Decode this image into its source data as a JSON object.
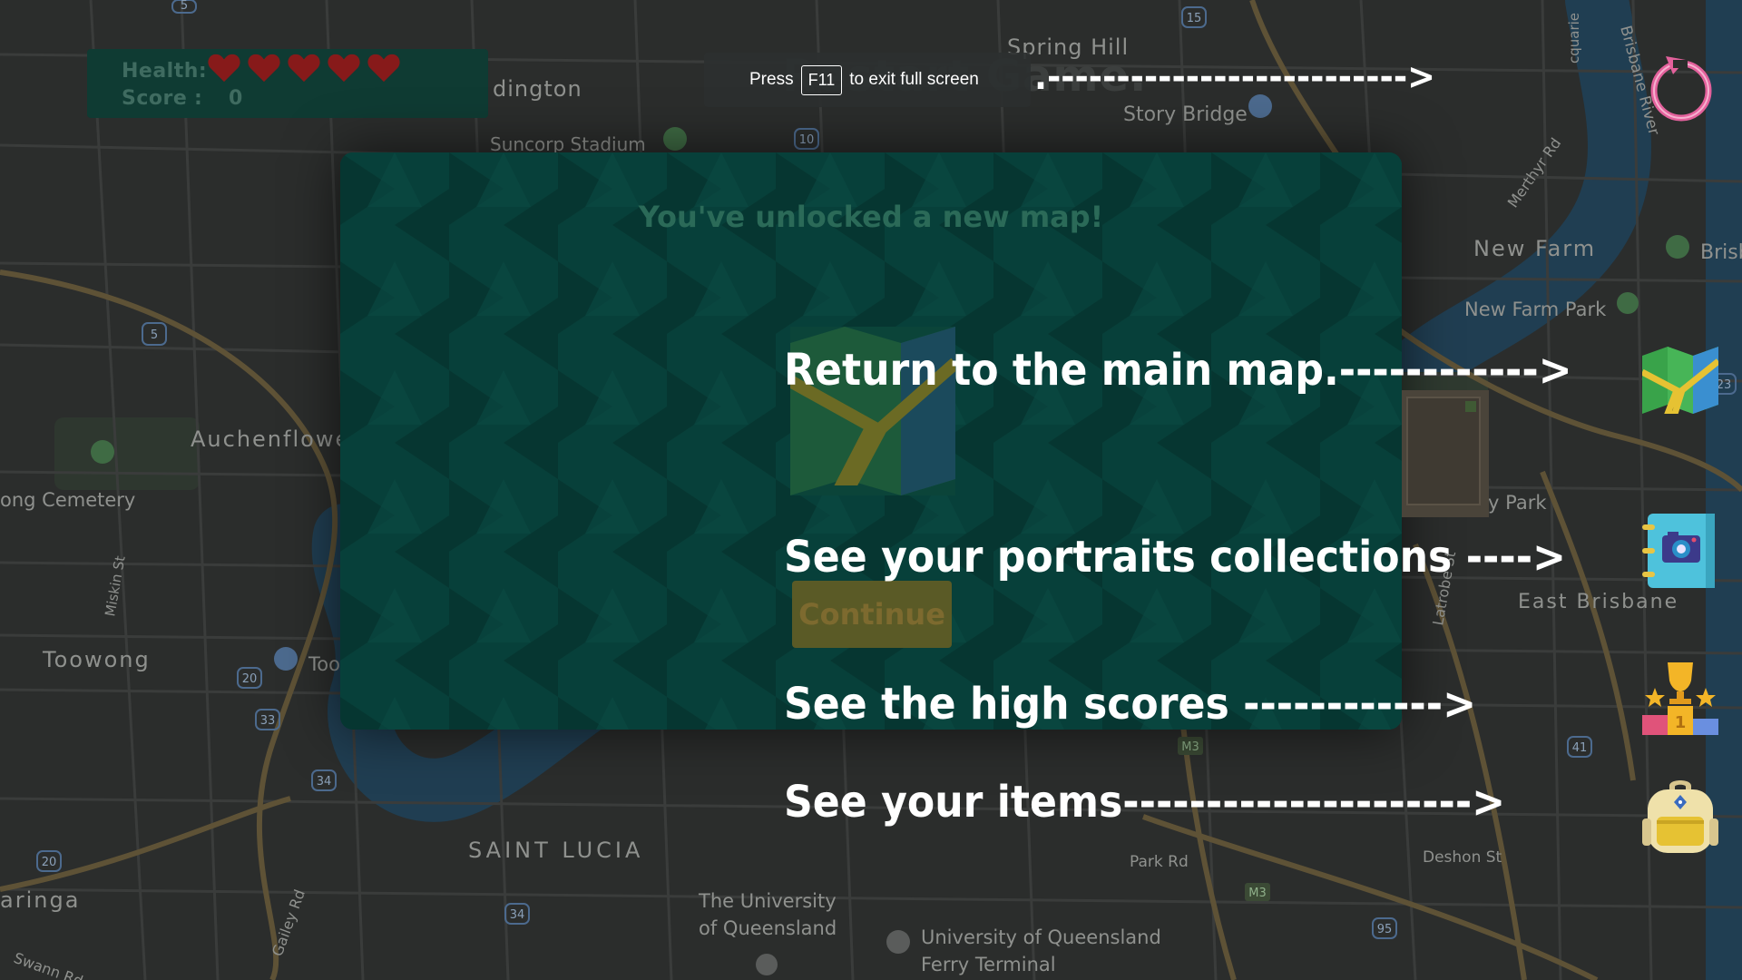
{
  "hud": {
    "health_label": "Health:",
    "score_label": "Score",
    "score_sep": ":",
    "score_value": "0",
    "hearts": 5
  },
  "fullscreen_notice": {
    "prefix": "Press",
    "key": "F11",
    "suffix": "to exit full screen"
  },
  "restart_title": "Restart Game.",
  "modal": {
    "title": "You've unlocked a new map!",
    "continue_label": "Continue"
  },
  "hints": {
    "restart_arrow": ".-------------------------->",
    "main_map": "Return to the main map.------------>",
    "portraits": "See your portraits collections ---->",
    "high_scores": "See the high scores ------------>",
    "items": "See your items--------------------->"
  },
  "map_labels": {
    "spring_hill": "Spring Hill",
    "paddington": "dington",
    "story_bridge": "Story Bridge",
    "suncorp": "Suncorp Stadium",
    "new_farm": "New Farm",
    "new_farm_park": "New Farm Park",
    "brisbane": "Brisb",
    "auchenflower": "Auchenflowe",
    "cemetery": "ong Cemetery",
    "toowong": "Toowong",
    "toowong2": "Too",
    "east_brisbane": "East Brisbane",
    "saint_lucia": "SAINT LUCIA",
    "taringa": "aringa",
    "uq": "The University",
    "uq2": "of Queensland",
    "uq_ferry": "University of Queensland",
    "uq_ferry2": "Ferry Terminal",
    "park_rd": "Park Rd",
    "deshon": "Deshon St",
    "merthyr": "Merthyr Rd",
    "latrobe": "Latrobe St",
    "gailey": "Gailey Rd",
    "swann": "Swann Rd",
    "miskin": "Miskin St",
    "park_label": "y Park",
    "brisbane_river": "Brisbane River",
    "macquarie": "cquarie",
    "route_15": "15",
    "route_10": "10",
    "route_5": "5",
    "route_20": "20",
    "route_33": "33",
    "route_34": "34",
    "route_20b": "20",
    "route_34b": "34",
    "route_41": "41",
    "route_95": "95",
    "route_m3": "M3",
    "route_m3b": "M3",
    "route_23": "23",
    "route_5b": "5"
  },
  "colors": {
    "map_bg": "#2a2c2b",
    "modal_bg": "#07403a",
    "hud_bg": "#0f3b33",
    "heart": "#8a1c1c",
    "restart_icon": "#e0609a",
    "road_major": "#5d5335",
    "river": "#1b3f5c"
  },
  "icons": {
    "restart": "restart-icon",
    "map": "folded-map-icon",
    "portraits": "camera-album-icon",
    "high_scores": "trophy-podium-icon",
    "items": "backpack-icon"
  }
}
